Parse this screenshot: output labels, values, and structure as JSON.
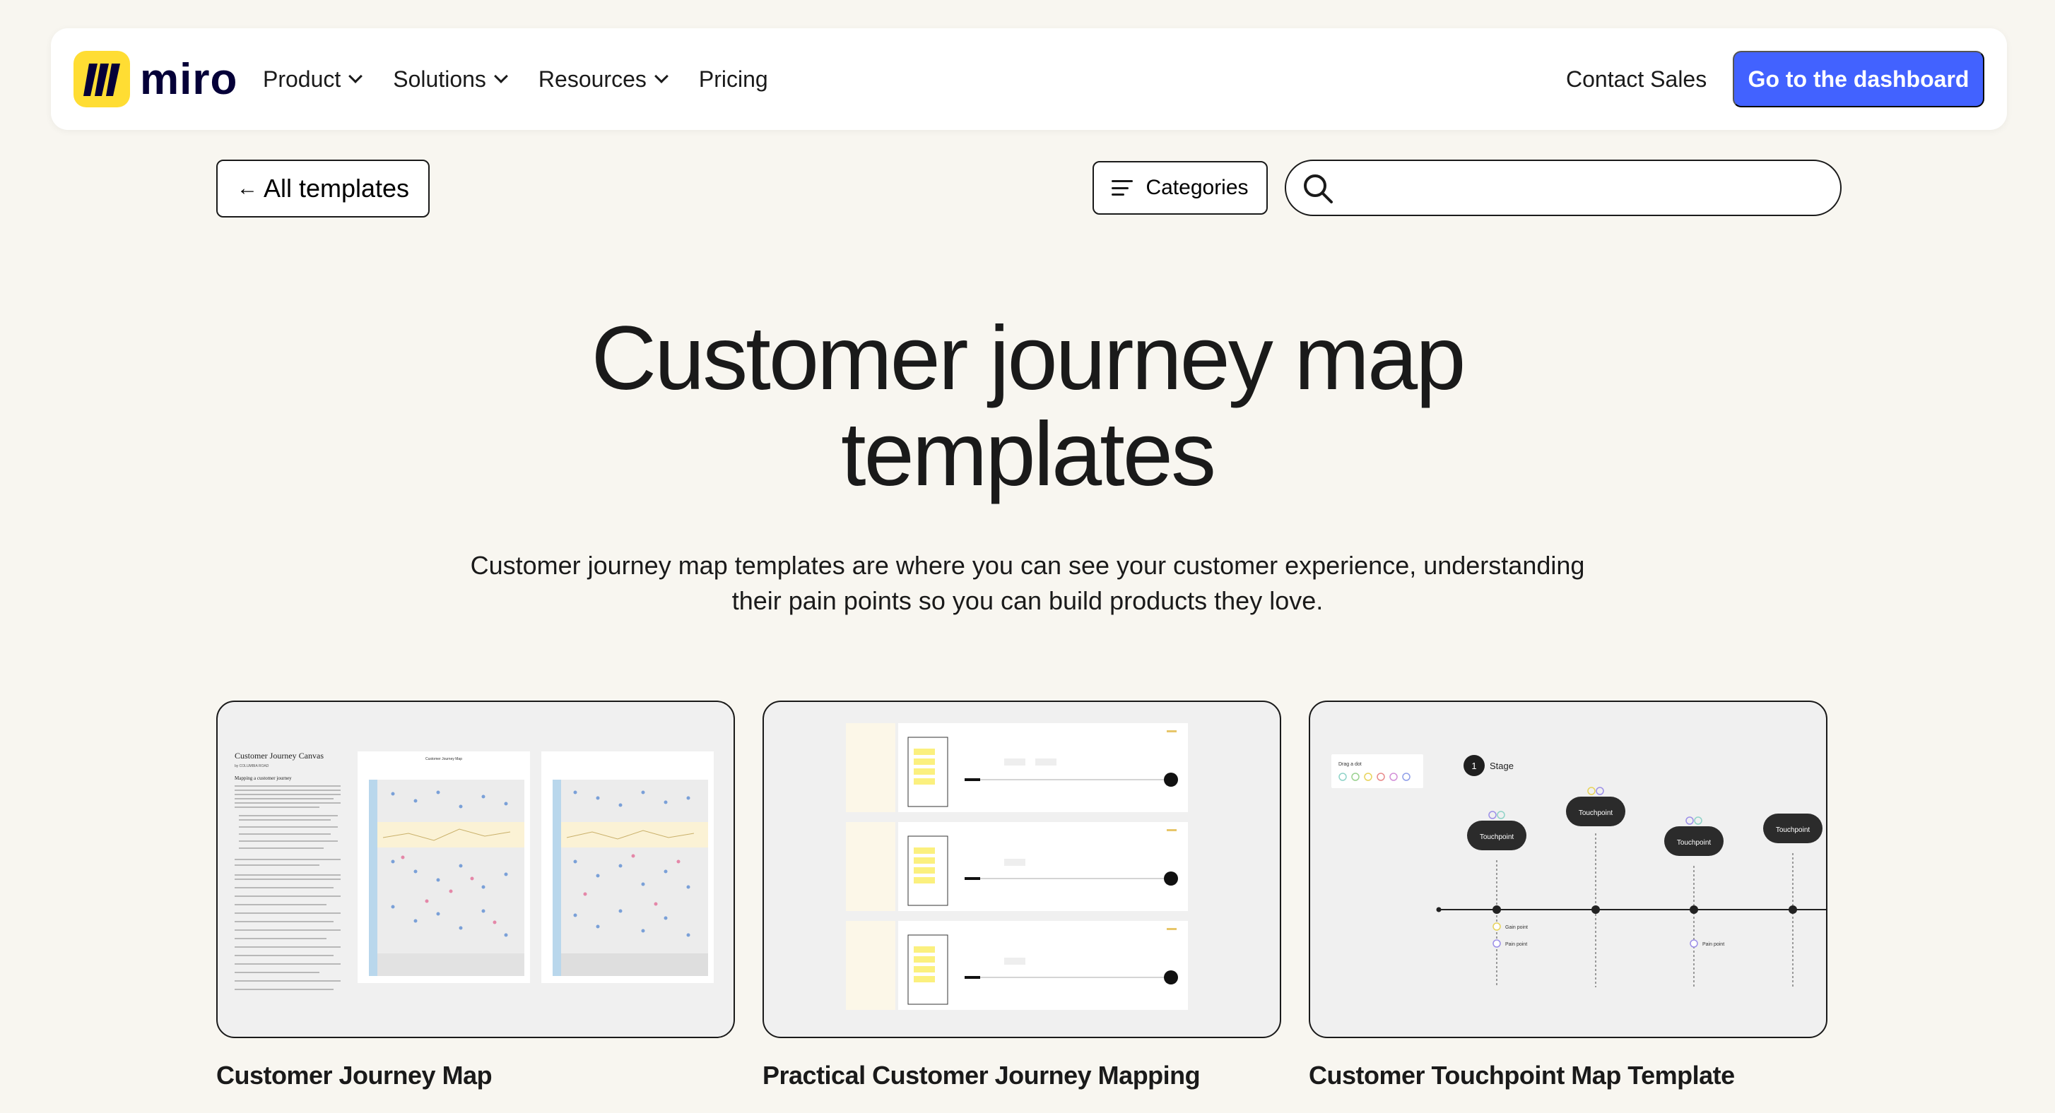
{
  "brand": {
    "name": "miro",
    "logo_color": "#ffdd33"
  },
  "nav": {
    "items": [
      {
        "label": "Product",
        "has_dropdown": true
      },
      {
        "label": "Solutions",
        "has_dropdown": true
      },
      {
        "label": "Resources",
        "has_dropdown": true
      },
      {
        "label": "Pricing",
        "has_dropdown": false
      }
    ],
    "contact_label": "Contact Sales",
    "dashboard_label": "Go to the dashboard",
    "accent": "#4262ff"
  },
  "toolbar": {
    "back_label": "All templates",
    "categories_label": "Categories",
    "search_placeholder": ""
  },
  "hero": {
    "title_line1": "Customer journey map",
    "title_line2": "templates",
    "description_line1": "Customer journey map templates are where you can see your customer experience, understanding",
    "description_line2": "their pain points so you can build products they love."
  },
  "cards": [
    {
      "title": "Customer Journey Map",
      "preview_heading": "Customer Journey Canvas",
      "preview_byline": "by COLUMBIA ROAD",
      "preview_subheading": "Mapping a customer journey",
      "preview_map_title": "Customer Journey Map"
    },
    {
      "title": "Practical Customer Journey Mapping"
    },
    {
      "title": "Customer Touchpoint Map Template",
      "preview_drag_label": "Drag a dot",
      "preview_stage_number": "1",
      "preview_stage_label": "Stage",
      "preview_touchpoint_label": "Touchpoint",
      "preview_gain_label": "Gain point",
      "preview_pain_label": "Pain point"
    }
  ]
}
